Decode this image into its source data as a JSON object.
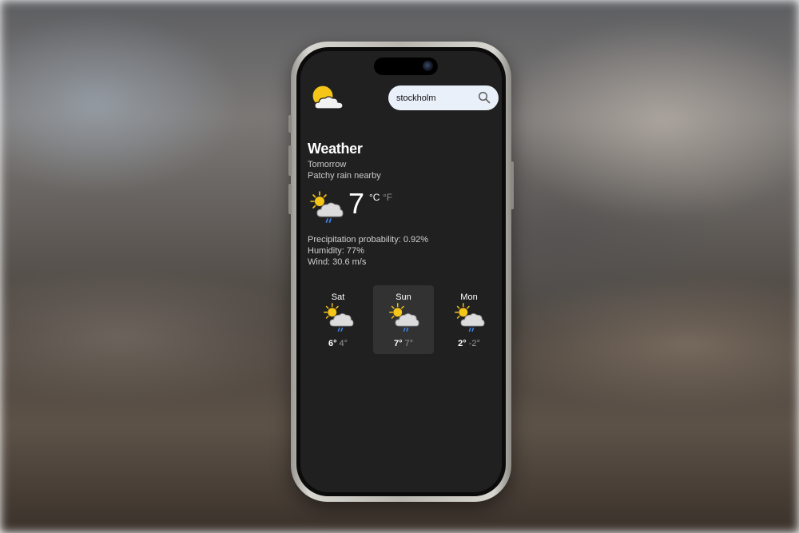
{
  "search": {
    "value": "stockholm",
    "icon": "search-icon"
  },
  "app": {
    "title": "Weather",
    "logo_icon": "sun-behind-cloud-icon"
  },
  "current": {
    "day": "Tomorrow",
    "condition": "Patchy rain nearby",
    "icon": "sun-cloud-rain-icon",
    "temperature": "7",
    "unit_c": "°C",
    "unit_f": "°F",
    "precipitation": "Precipitation probability: 0.92%",
    "humidity": "Humidity: 77%",
    "wind": "Wind: 30.6 m/s"
  },
  "forecast": [
    {
      "day": "Sat",
      "high": "6°",
      "low": "4°",
      "icon": "sun-cloud-rain-icon",
      "selected": false
    },
    {
      "day": "Sun",
      "high": "7°",
      "low": "7°",
      "icon": "sun-cloud-rain-icon",
      "selected": true
    },
    {
      "day": "Mon",
      "high": "2°",
      "low": "-2°",
      "icon": "sun-cloud-rain-icon",
      "selected": false
    }
  ],
  "colors": {
    "screen_bg": "#202020",
    "selected_day_bg": "#323232",
    "search_bg": "#eaf0fa",
    "sun": "#f5c518",
    "rain": "#3d7fe0"
  }
}
